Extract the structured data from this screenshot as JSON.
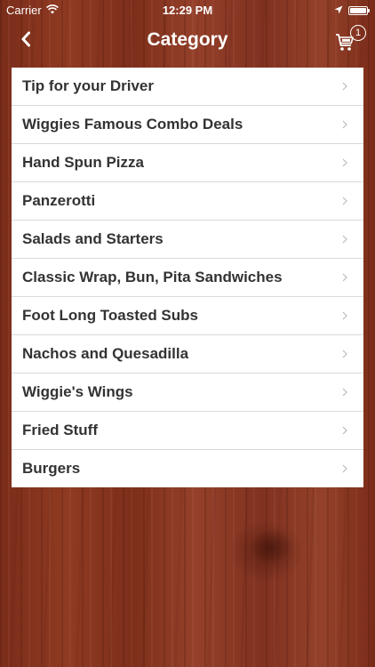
{
  "status_bar": {
    "carrier": "Carrier",
    "time": "12:29 PM",
    "icons": [
      "wifi-icon",
      "location-arrow-icon",
      "battery-icon"
    ]
  },
  "nav": {
    "title": "Category",
    "back_icon": "chevron-left-icon",
    "cart_icon": "cart-icon",
    "cart_count": "1"
  },
  "categories": [
    {
      "label": "Tip for your Driver"
    },
    {
      "label": "Wiggies Famous Combo Deals"
    },
    {
      "label": "Hand Spun Pizza"
    },
    {
      "label": "Panzerotti"
    },
    {
      "label": "Salads and Starters"
    },
    {
      "label": "Classic Wrap, Bun, Pita Sandwiches"
    },
    {
      "label": "Foot Long Toasted Subs"
    },
    {
      "label": "Nachos and Quesadilla"
    },
    {
      "label": "Wiggie's Wings"
    },
    {
      "label": "Fried Stuff"
    },
    {
      "label": "Burgers"
    }
  ],
  "colors": {
    "background_wood": "#8a3620",
    "list_background": "#ffffff",
    "text_primary": "#333333",
    "chevron": "#bbbbbb"
  }
}
